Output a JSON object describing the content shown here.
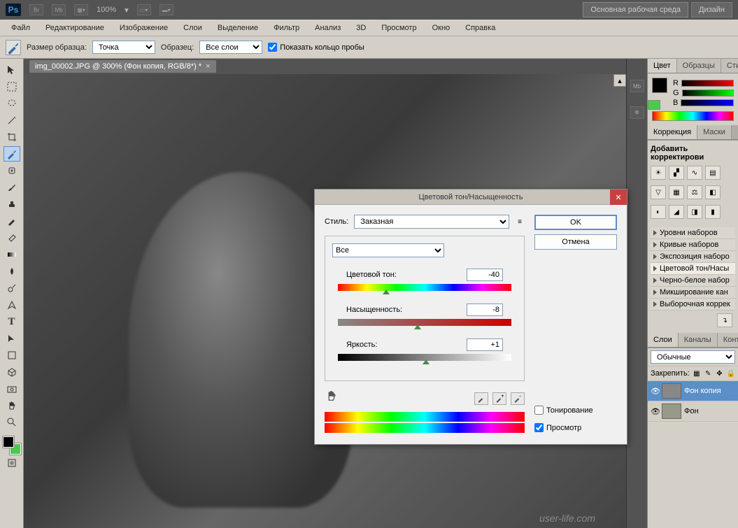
{
  "top": {
    "logo": "Ps",
    "br": "Br",
    "mb": "Mb",
    "zoom": "100%",
    "workspace_main": "Основная рабочая среда",
    "workspace_design": "Дизайн"
  },
  "menu": [
    "Файл",
    "Редактирование",
    "Изображение",
    "Слои",
    "Выделение",
    "Фильтр",
    "Анализ",
    "3D",
    "Просмотр",
    "Окно",
    "Справка"
  ],
  "options": {
    "sample_size_label": "Размер образца:",
    "sample_size_value": "Точка",
    "sample_label": "Образец:",
    "sample_value": "Все слои",
    "show_ring": "Показать кольцо пробы"
  },
  "doc_tab": "img_00002.JPG @ 300% (Фон копия, RGB/8*) *",
  "right": {
    "color_tab": "Цвет",
    "swatches_tab": "Образцы",
    "styles_tab": "Стил",
    "r": "R",
    "g": "G",
    "b": "B",
    "corrections_tab": "Коррекция",
    "masks_tab": "Маски",
    "add_layer": "Добавить корректирови",
    "presets": [
      "Уровни наборов",
      "Кривые наборов",
      "Экспозиция наборо",
      "Цветовой тон/Насы",
      "Черно-белое набор",
      "Микширование кан",
      "Выборочная коррек"
    ],
    "layers_tab": "Слои",
    "channels_tab": "Каналы",
    "paths_tab": "Конту",
    "blend_mode": "Обычные",
    "lock_label": "Закрепить:",
    "layer1": "Фон копия",
    "layer2": "Фон"
  },
  "dialog": {
    "title": "Цветовой тон/Насыщенность",
    "style_label": "Стиль:",
    "style_value": "Заказная",
    "channel": "Все",
    "hue_label": "Цветовой тон:",
    "hue_value": "-40",
    "sat_label": "Насыщенность:",
    "sat_value": "-8",
    "light_label": "Яркость:",
    "light_value": "+1",
    "ok": "OK",
    "cancel": "Отмена",
    "colorize": "Тонирование",
    "preview": "Просмотр"
  },
  "watermark": "user-life.com",
  "rs_btn": "Mb"
}
